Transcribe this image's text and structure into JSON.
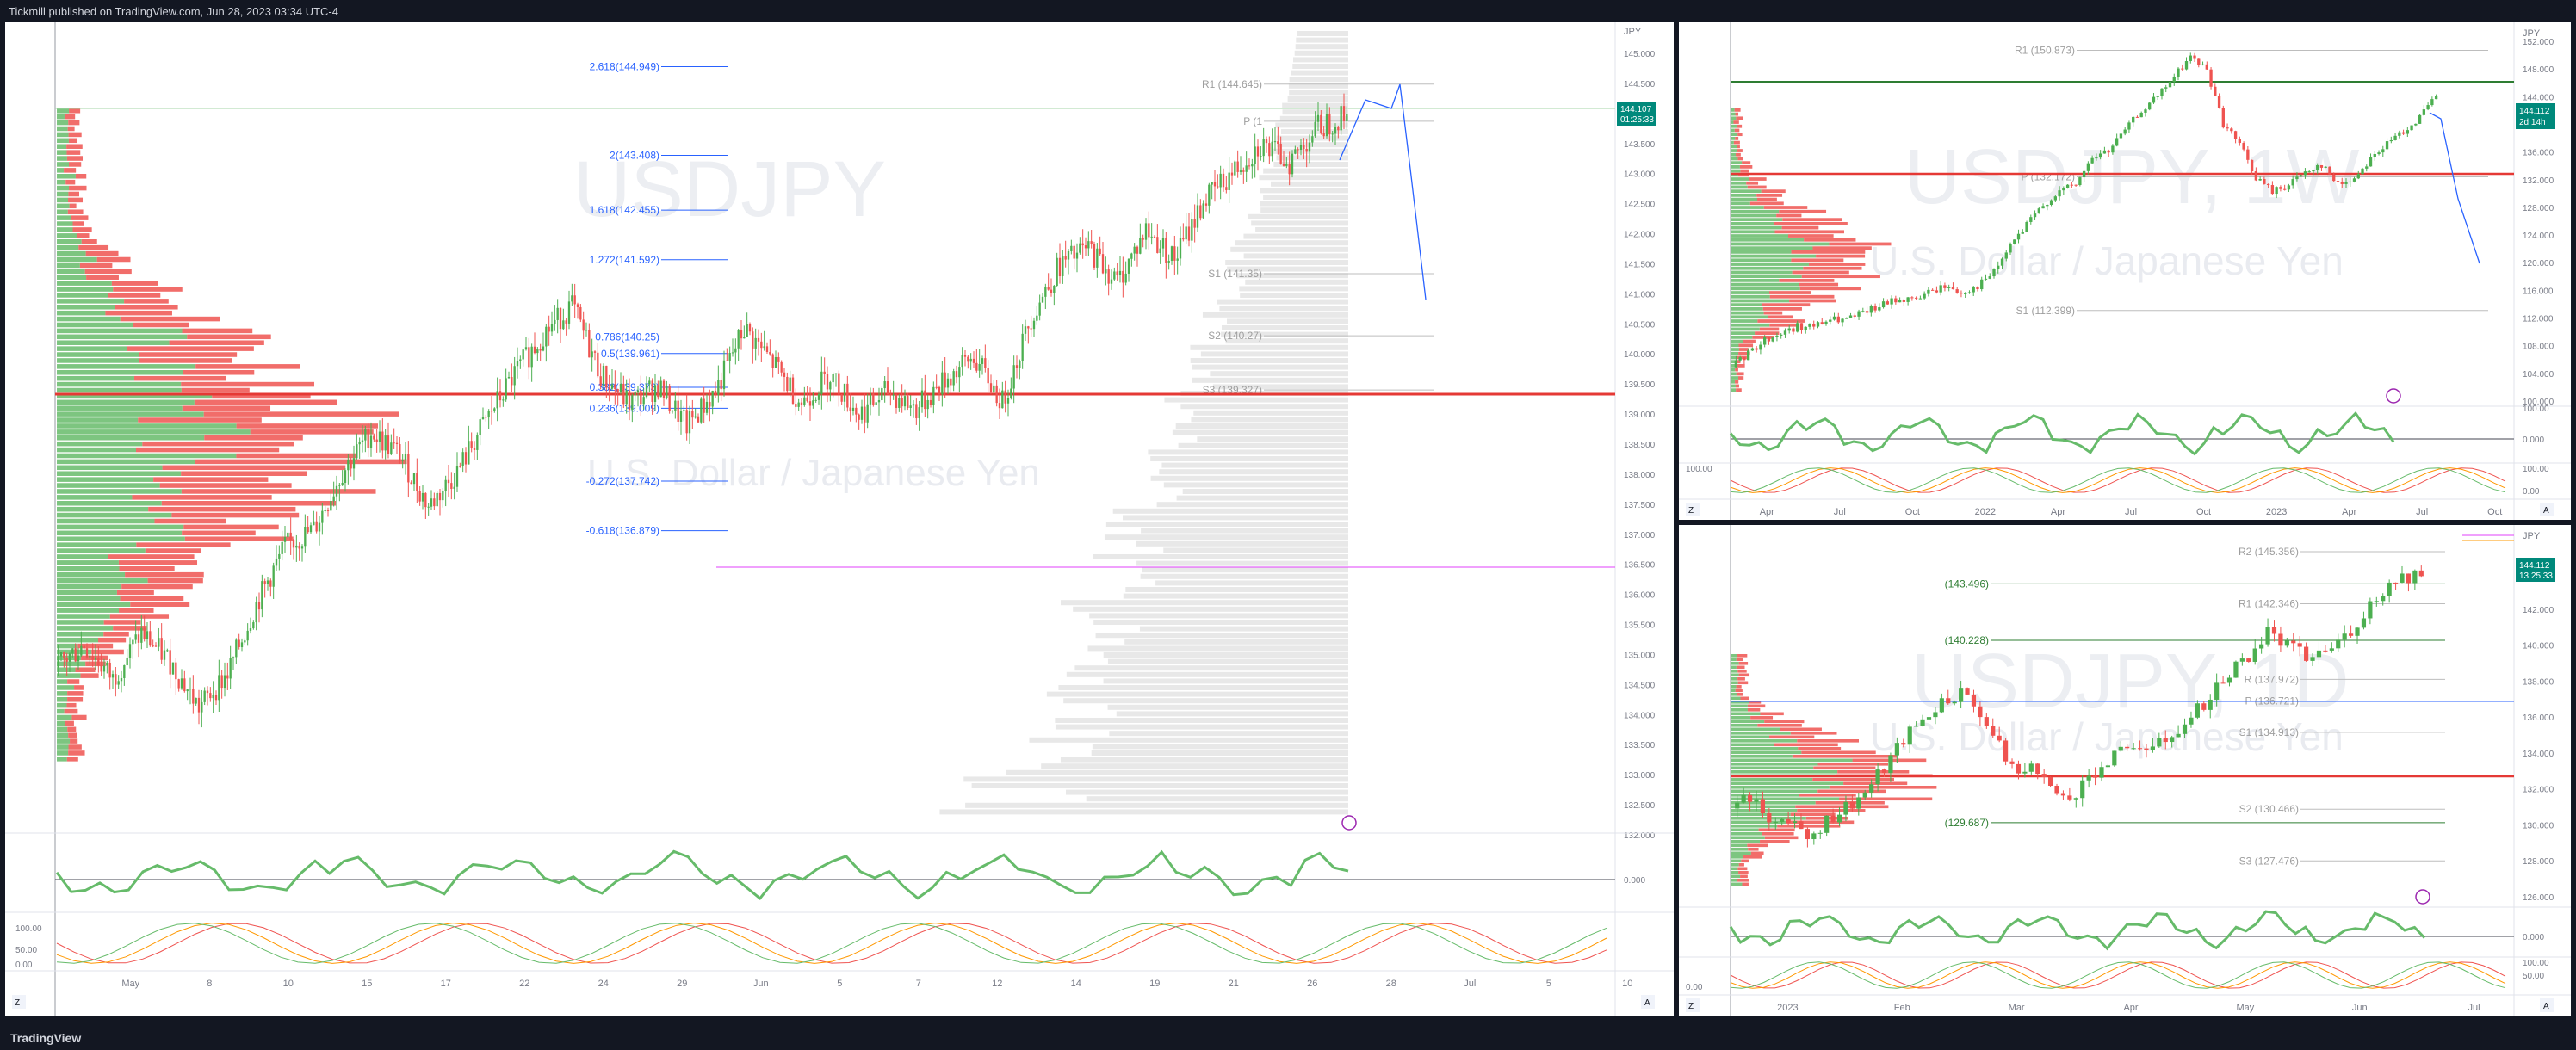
{
  "header": {
    "publish_line": "Tickmill published on TradingView.com, Jun 28, 2023 03:34 UTC-4"
  },
  "footer": {
    "brand": "TradingView"
  },
  "colors": {
    "up": "#4caf50",
    "down": "#ef5350",
    "pivot": "#9e9e9e",
    "fib": "#2962ff",
    "background": "#ffffff"
  },
  "main": {
    "currency": "JPY",
    "price_tag": {
      "value": "144.107",
      "countdown": "01:25:33"
    },
    "watermark": {
      "symbol": "USDJPY",
      "name": "U.S. Dollar / Japanese Yen"
    },
    "fib_labels": [
      "2.618(144.949)",
      "2(143.408)",
      "1.618(142.455)",
      "1.272(141.592)",
      "0.786(140.25)",
      "0.5(139.961)",
      "0.382(139.373)",
      "0.236(139.009)",
      "-0.272(137.742)",
      "-0.618(136.879)"
    ],
    "pivot_labels": [
      "R1 (144.645)",
      "P (1",
      "S1 (141.35)",
      "S2 (140.27)",
      "S3 (139.327)"
    ],
    "price_axis": [
      "145.000",
      "144.500",
      "144.000",
      "143.500",
      "143.000",
      "142.500",
      "142.000",
      "141.500",
      "141.000",
      "140.500",
      "140.000",
      "139.500",
      "139.000",
      "138.500",
      "138.000",
      "137.500",
      "137.000",
      "136.500",
      "136.000",
      "135.500",
      "135.000",
      "134.500",
      "134.000",
      "133.500",
      "133.000",
      "132.500",
      "132.000"
    ],
    "time_axis": [
      "May",
      "8",
      "10",
      "15",
      "17",
      "22",
      "24",
      "29",
      "Jun",
      "5",
      "7",
      "12",
      "14",
      "19",
      "21",
      "26",
      "28",
      "Jul",
      "5",
      "10"
    ],
    "rsi_axis": [
      "0.000"
    ],
    "stoch_axis": [
      "100.00",
      "50.00",
      "0.00"
    ]
  },
  "weekly": {
    "currency": "JPY",
    "price_tag": {
      "value": "144.112",
      "countdown": "2d 14h"
    },
    "watermark": {
      "symbol": "USDJPY, 1W",
      "name": "U.S. Dollar / Japanese Yen"
    },
    "pivot_labels": [
      "R1 (150.873)",
      "P (132.172)",
      "S1 (112.399)"
    ],
    "price_axis": [
      "152.000",
      "148.000",
      "144.000",
      "140.000",
      "136.000",
      "132.000",
      "128.000",
      "124.000",
      "120.000",
      "116.000",
      "112.000",
      "108.000",
      "104.000",
      "100.000"
    ],
    "time_axis": [
      "Apr",
      "Jul",
      "Oct",
      "2022",
      "Apr",
      "Jul",
      "Oct",
      "2023",
      "Apr",
      "Jul",
      "Oct"
    ],
    "rsi_axis": [
      "100.00",
      "0.000"
    ],
    "stoch_axis": [
      "100.00",
      "100.00",
      "0.00"
    ]
  },
  "daily": {
    "currency": "JPY",
    "price_tag": {
      "value": "144.112",
      "countdown": "13:25:33"
    },
    "watermark": {
      "symbol": "USDJPY, 1D",
      "name": "U.S. Dollar / Japanese Yen"
    },
    "level_labels": [
      "(143.496)",
      "(140.228)",
      "(129.687)"
    ],
    "pivot_labels": [
      "R2 (145.356)",
      "R1 (142.346)",
      "R (137.972)",
      "P (136.721)",
      "S1 (134.913)",
      "S2 (130.466)",
      "S3 (127.476)"
    ],
    "price_axis": [
      "144.000",
      "142.000",
      "140.000",
      "138.000",
      "136.000",
      "134.000",
      "132.000",
      "130.000",
      "128.000",
      "126.000"
    ],
    "time_axis": [
      "2023",
      "Feb",
      "Mar",
      "Apr",
      "May",
      "Jun",
      "Jul"
    ],
    "rsi_axis": [
      "0.000"
    ],
    "stoch_axis": [
      "100.00",
      "50.00",
      "0.00"
    ]
  },
  "chart_data": [
    {
      "type": "candlestick",
      "title": "U.S. Dollar / Japanese Yen",
      "symbol": "USDJPY",
      "ylim": [
        131.8,
        145.6
      ],
      "last": 144.107,
      "fib_levels": [
        {
          "ratio": 2.618,
          "price": 144.949
        },
        {
          "ratio": 2,
          "price": 143.408
        },
        {
          "ratio": 1.618,
          "price": 142.455
        },
        {
          "ratio": 1.272,
          "price": 141.592
        },
        {
          "ratio": 0.786,
          "price": 140.25
        },
        {
          "ratio": 0.5,
          "price": 139.961
        },
        {
          "ratio": 0.382,
          "price": 139.373
        },
        {
          "ratio": 0.236,
          "price": 139.009
        },
        {
          "ratio": -0.272,
          "price": 137.742
        },
        {
          "ratio": -0.618,
          "price": 136.879
        }
      ],
      "pivots": {
        "R1": 144.645,
        "S1": 141.35,
        "S2": 140.27,
        "S3": 139.327
      },
      "path": [
        134.5,
        134.9,
        134.3,
        135.1,
        134.6,
        133.8,
        134.4,
        135.6,
        136.6,
        136.9,
        137.9,
        138.6,
        138.2,
        137.3,
        137.9,
        138.8,
        139.6,
        140.3,
        140.8,
        139.6,
        139.1,
        139.4,
        138.7,
        139.3,
        140.4,
        139.8,
        139.1,
        139.6,
        138.9,
        139.3,
        139.0,
        139.5,
        139.9,
        139.1,
        140.6,
        141.5,
        141.8,
        141.2,
        142.1,
        141.6,
        142.6,
        143.1,
        143.6,
        143.3,
        143.9,
        144.1
      ]
    },
    {
      "type": "candlestick",
      "title": "U.S. Dollar / Japanese Yen",
      "symbol": "USDJPY, 1W",
      "ylim": [
        99,
        154
      ],
      "last": 144.112,
      "pivots": {
        "R1": 150.873,
        "P": 132.172,
        "S1": 112.399
      },
      "path": [
        104,
        106,
        108,
        109,
        110,
        110,
        111,
        111,
        112,
        113,
        114,
        114,
        115,
        116,
        115,
        116,
        118,
        122,
        125,
        128,
        130,
        131,
        135,
        136,
        139,
        142,
        144,
        147,
        150,
        148,
        140,
        137,
        132,
        130,
        131,
        133,
        134,
        131,
        132,
        135,
        137,
        139,
        141,
        144
      ]
    },
    {
      "type": "candlestick",
      "title": "U.S. Dollar / Japanese Yen",
      "symbol": "USDJPY, 1D",
      "ylim": [
        125.5,
        146.2
      ],
      "last": 144.112,
      "levels": [
        143.496,
        140.228,
        129.687
      ],
      "pivots": {
        "R2": 145.356,
        "R1": 142.346,
        "P": 136.721,
        "S1": 134.913,
        "S2": 130.466,
        "S3": 127.476
      },
      "path": [
        130.5,
        131.2,
        129.5,
        130.1,
        128.9,
        129.8,
        130.6,
        131.4,
        132.8,
        134.5,
        135.6,
        136.7,
        137.2,
        136.1,
        134.0,
        132.5,
        132.9,
        131.1,
        131.5,
        132.7,
        133.4,
        134.3,
        133.8,
        134.9,
        135.7,
        137.1,
        138.3,
        139.4,
        140.7,
        139.9,
        139.2,
        139.6,
        140.4,
        141.8,
        143.2,
        143.9,
        144.1
      ]
    }
  ]
}
